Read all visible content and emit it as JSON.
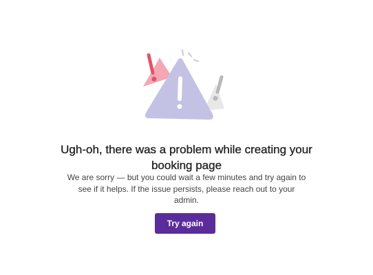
{
  "error": {
    "title": "Ugh-oh, there was a problem while creating your booking page",
    "message": "We are sorry — but you could wait a few minutes and try again to see if it helps. If the issue persists, please reach out to your admin.",
    "try_again_label": "Try again",
    "illustration_icon": "warning-triangles-icon"
  },
  "colors": {
    "primary_button": "#5b2c9b",
    "main_triangle": "#c4c2e4",
    "pink_triangle": "#f5a7b4",
    "red_exclamation": "#e05468",
    "gray_triangle": "#e4e4e4",
    "gray_exclamation": "#b8b8b8",
    "title_text": "#242424",
    "body_text": "#424242"
  }
}
